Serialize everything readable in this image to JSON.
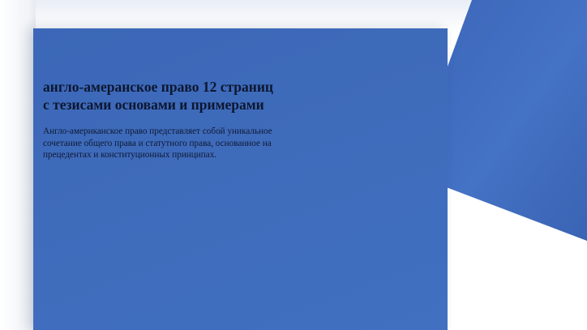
{
  "document": {
    "title": "англо-амеранское право 12 страниц\nс тезисами основами и примерами",
    "description": "Англо-американское право представляет собой уникальное\nсочетание общего права и статутного права, основанное на\nпрецедентах и конституционных принципах."
  },
  "colors": {
    "card_blue": "#3f6bbb",
    "accent_blue": "#4270c2",
    "text_dark": "#0c1730",
    "background": "#ffffff"
  }
}
